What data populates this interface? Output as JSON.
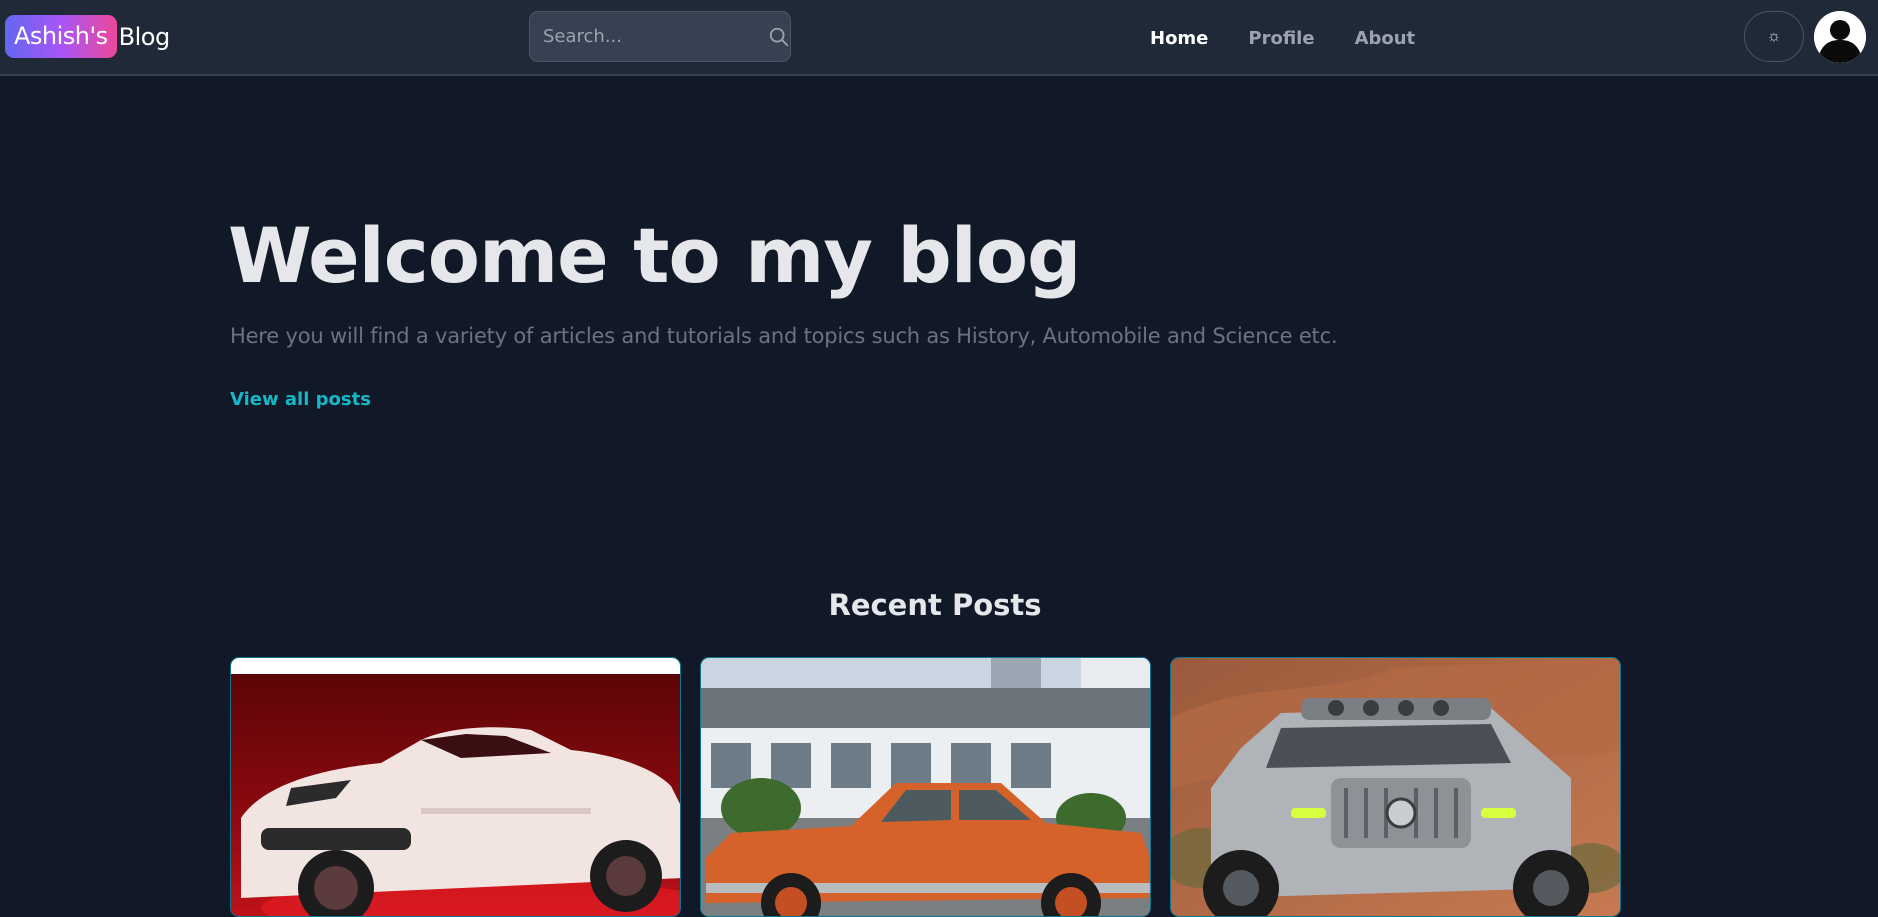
{
  "header": {
    "logo_badge": "Ashish's",
    "logo_rest": "Blog",
    "search": {
      "placeholder": "Search..."
    },
    "nav": [
      {
        "label": "Home",
        "active": true
      },
      {
        "label": "Profile",
        "active": false
      },
      {
        "label": "About",
        "active": false
      }
    ],
    "theme_toggle_glyph": "☼"
  },
  "hero": {
    "title": "Welcome to my blog",
    "subtitle": "Here you will find a variety of articles and tutorials and topics such as History, Automobile and Science etc.",
    "cta": "View all posts"
  },
  "recent": {
    "title": "Recent Posts",
    "posts": [
      {
        "image": "white-convertible-sports-car"
      },
      {
        "image": "orange-vintage-sedan"
      },
      {
        "image": "silver-offroad-suv"
      }
    ]
  },
  "colors": {
    "background": "#111827",
    "navbar": "#1f2937",
    "accent": "#14b8c6",
    "logo_gradient": [
      "#6366f1",
      "#a855f7",
      "#ec4899"
    ]
  }
}
